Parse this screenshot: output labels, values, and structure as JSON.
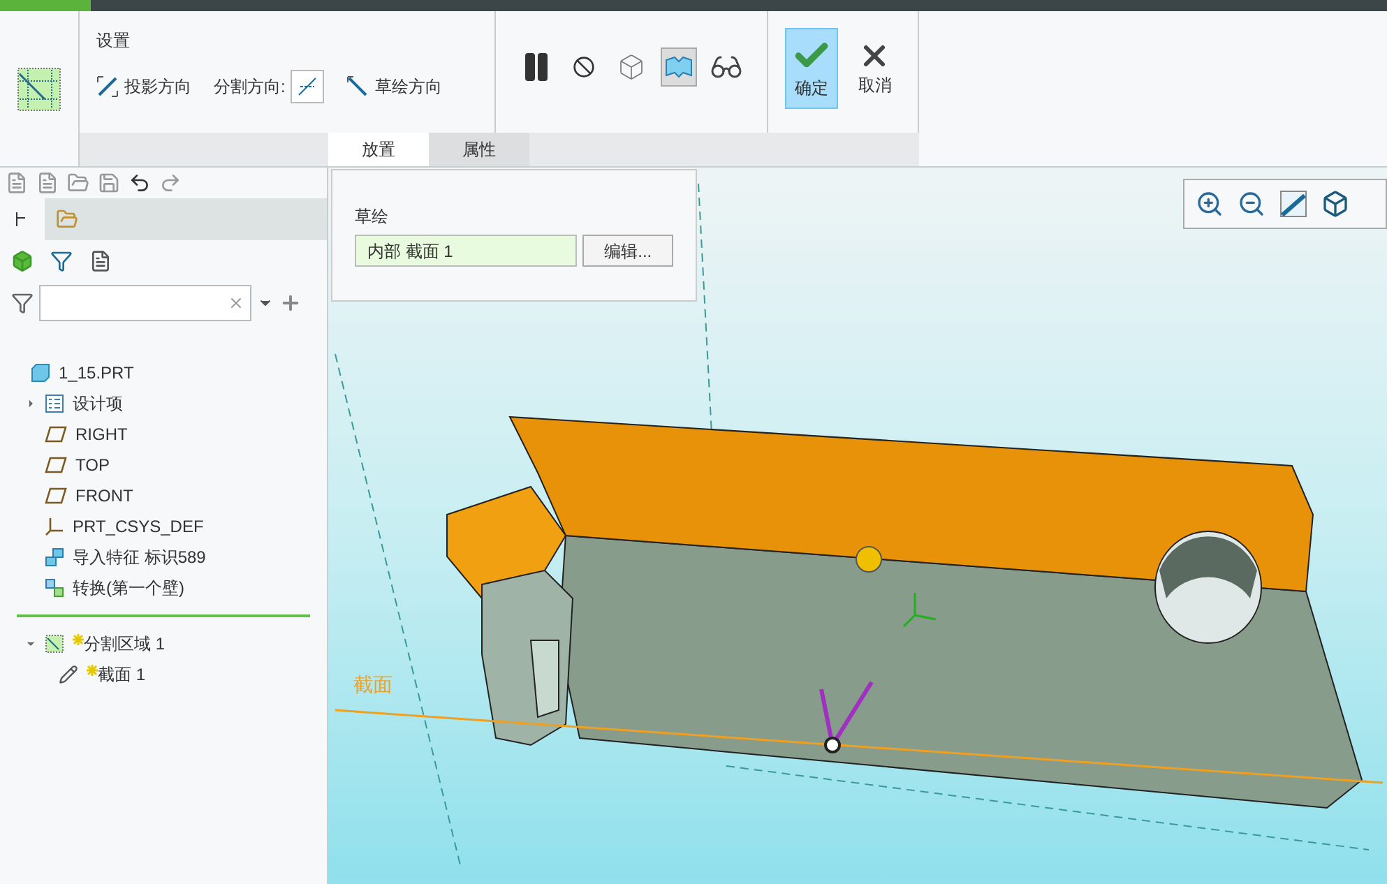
{
  "ribbon": {
    "settings": {
      "title": "设置",
      "projection_button": "投影方向",
      "split_direction_label": "分割方向:",
      "sketch_direction_button": "草绘方向"
    },
    "toggles": [
      {
        "kind": "pause",
        "selected": false
      },
      {
        "kind": "disable",
        "selected": false
      },
      {
        "kind": "preview",
        "selected": false
      },
      {
        "kind": "verify",
        "selected": true
      },
      {
        "kind": "glasses",
        "selected": false
      }
    ],
    "ok_button": {
      "label": "确定",
      "selected": true
    },
    "cancel_button": {
      "label": "取消"
    },
    "tabs": [
      {
        "label": "放置",
        "selected": true
      },
      {
        "label": "属性",
        "selected": false
      }
    ]
  },
  "placement_panel": {
    "label": "草绘",
    "field_value": "内部 截面 1",
    "edit_button": "编辑..."
  },
  "model_tree": {
    "items": [
      {
        "kind": "part",
        "label": "1_15.PRT",
        "children": [
          {
            "kind": "layers",
            "label": "设计项",
            "expanded": false
          },
          {
            "kind": "plane",
            "label": "RIGHT"
          },
          {
            "kind": "plane",
            "label": "TOP"
          },
          {
            "kind": "plane",
            "label": "FRONT"
          },
          {
            "kind": "csys",
            "label": "PRT_CSYS_DEF"
          },
          {
            "kind": "import",
            "label": "导入特征 标识589"
          },
          {
            "kind": "convert",
            "label": "转换(第一个壁)"
          }
        ]
      }
    ],
    "after_insert": [
      {
        "kind": "split",
        "label": "分割区域 1",
        "new": true,
        "expanded": true,
        "children": [
          {
            "kind": "sketch",
            "label": "截面 1",
            "new": true
          }
        ]
      }
    ]
  },
  "viewport": {
    "section_label": "截面"
  }
}
